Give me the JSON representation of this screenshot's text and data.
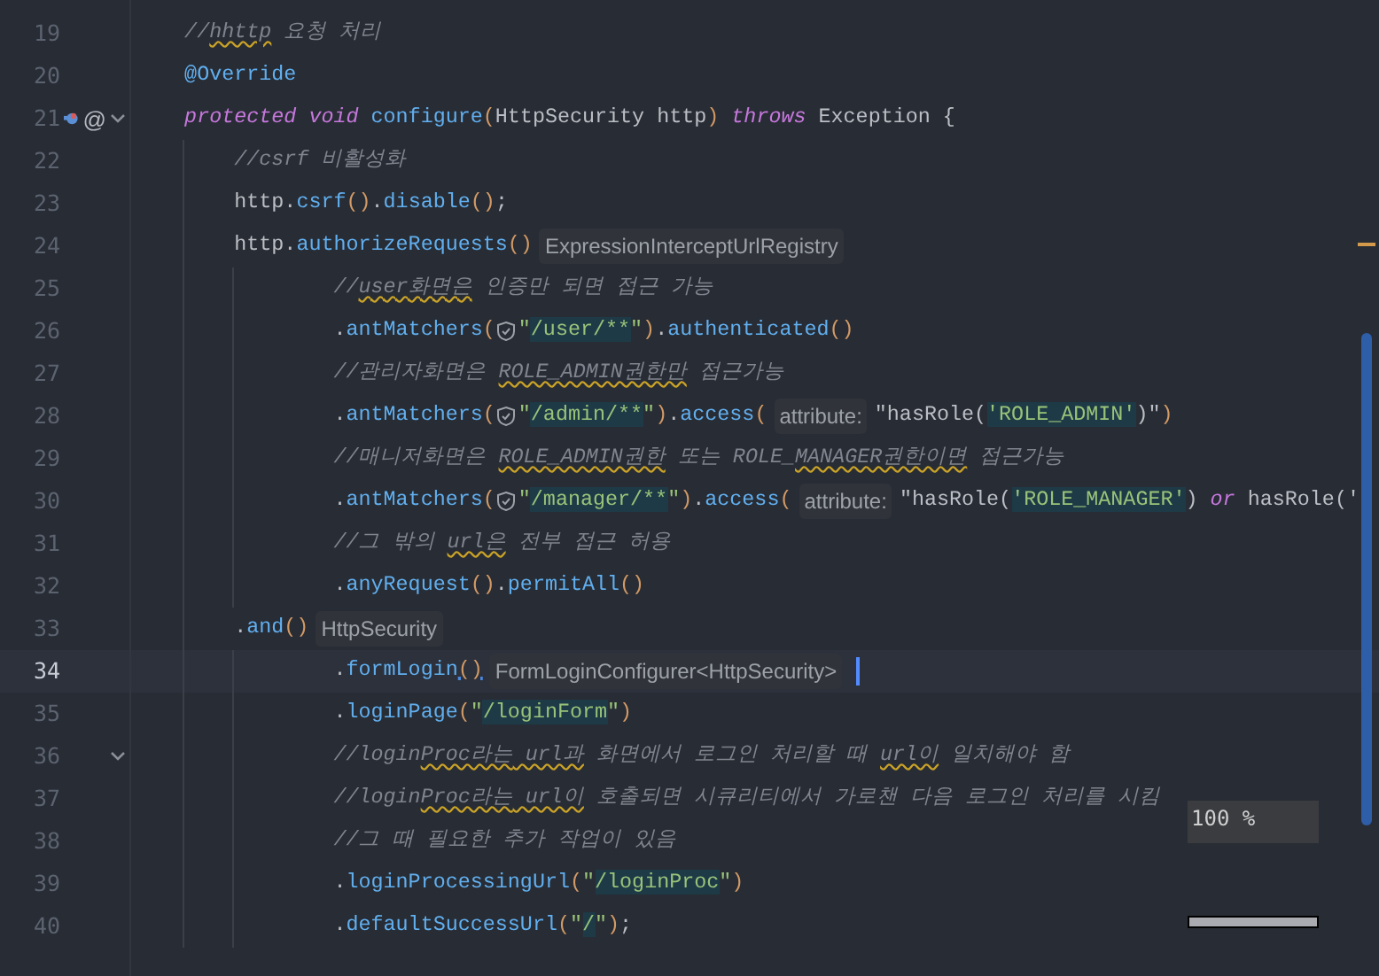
{
  "editor": {
    "lines": [
      {
        "number": "19",
        "current": false,
        "foldable": false,
        "tokens": [
          {
            "kind": "comment",
            "text": "    //"
          },
          {
            "kind": "comment_typo",
            "text": "hhttp"
          },
          {
            "kind": "comment",
            "text": " 요청 처리"
          }
        ]
      },
      {
        "number": "20",
        "current": false,
        "foldable": false,
        "tokens": [
          {
            "kind": "annotation",
            "text": "    @Override"
          }
        ]
      },
      {
        "number": "21",
        "current": false,
        "foldable": true,
        "gutter": [
          {
            "kind": "override"
          },
          {
            "kind": "glyph",
            "text": "@"
          }
        ],
        "tokens": [
          {
            "kind": "keyword",
            "text": "    protected void "
          },
          {
            "kind": "method",
            "text": "configure"
          },
          {
            "kind": "paren",
            "text": "("
          },
          {
            "kind": "plain",
            "text": "HttpSecurity http"
          },
          {
            "kind": "paren",
            "text": ")"
          },
          {
            "kind": "keyword",
            "text": " throws "
          },
          {
            "kind": "plain",
            "text": "Exception {"
          }
        ]
      },
      {
        "number": "22",
        "current": false,
        "foldable": false,
        "tokens": [
          {
            "kind": "comment",
            "text": "        //csrf 비활성화"
          }
        ]
      },
      {
        "number": "23",
        "current": false,
        "foldable": false,
        "tokens": [
          {
            "kind": "plain",
            "text": "        http."
          },
          {
            "kind": "method",
            "text": "csrf"
          },
          {
            "kind": "paren",
            "text": "()"
          },
          {
            "kind": "plain",
            "text": "."
          },
          {
            "kind": "method",
            "text": "disable"
          },
          {
            "kind": "paren",
            "text": "()"
          },
          {
            "kind": "plain",
            "text": ";"
          }
        ]
      },
      {
        "number": "24",
        "current": false,
        "foldable": false,
        "tokens": [
          {
            "kind": "plain",
            "text": "        http."
          },
          {
            "kind": "method",
            "text": "authorizeRequests"
          },
          {
            "kind": "paren",
            "text": "()"
          },
          {
            "kind": "hint",
            "text": "ExpressionInterceptUrlRegistry"
          }
        ]
      },
      {
        "number": "25",
        "current": false,
        "foldable": false,
        "tokens": [
          {
            "kind": "comment",
            "text": "                //"
          },
          {
            "kind": "comment_typo",
            "text": "user화면은"
          },
          {
            "kind": "comment",
            "text": " 인증만 되면 접근 가능"
          }
        ]
      },
      {
        "number": "26",
        "current": false,
        "foldable": false,
        "tokens": [
          {
            "kind": "plain",
            "text": "                ."
          },
          {
            "kind": "method",
            "text": "antMatchers"
          },
          {
            "kind": "paren",
            "text": "("
          },
          {
            "kind": "shield"
          },
          {
            "kind": "string",
            "text": "\""
          },
          {
            "kind": "string_hl",
            "text": "/user/**"
          },
          {
            "kind": "string",
            "text": "\""
          },
          {
            "kind": "paren",
            "text": ")"
          },
          {
            "kind": "plain",
            "text": "."
          },
          {
            "kind": "method",
            "text": "authenticated"
          },
          {
            "kind": "paren",
            "text": "()"
          }
        ]
      },
      {
        "number": "27",
        "current": false,
        "foldable": false,
        "tokens": [
          {
            "kind": "comment",
            "text": "                //관리자화면은 "
          },
          {
            "kind": "comment_typo",
            "text": "ROLE_ADMIN권한만"
          },
          {
            "kind": "comment",
            "text": " 접근가능"
          }
        ]
      },
      {
        "number": "28",
        "current": false,
        "foldable": false,
        "tokens": [
          {
            "kind": "plain",
            "text": "                ."
          },
          {
            "kind": "method",
            "text": "antMatchers"
          },
          {
            "kind": "paren",
            "text": "("
          },
          {
            "kind": "shield"
          },
          {
            "kind": "string",
            "text": "\""
          },
          {
            "kind": "string_hl",
            "text": "/admin/**"
          },
          {
            "kind": "string",
            "text": "\""
          },
          {
            "kind": "paren",
            "text": ")"
          },
          {
            "kind": "plain",
            "text": "."
          },
          {
            "kind": "method",
            "text": "access"
          },
          {
            "kind": "paren",
            "text": "("
          },
          {
            "kind": "hint",
            "text": "attribute:"
          },
          {
            "kind": "plain",
            "text": "\"hasRole("
          },
          {
            "kind": "string_hl",
            "text": "'ROLE_ADMIN'"
          },
          {
            "kind": "plain",
            "text": ")\""
          },
          {
            "kind": "paren",
            "text": ")"
          }
        ]
      },
      {
        "number": "29",
        "current": false,
        "foldable": false,
        "tokens": [
          {
            "kind": "comment",
            "text": "                //매니저화면은 "
          },
          {
            "kind": "comment_typo",
            "text": "ROLE_ADMIN권한"
          },
          {
            "kind": "comment",
            "text": " 또는 ROLE_"
          },
          {
            "kind": "comment_typo",
            "text": "MANAGER권한이면"
          },
          {
            "kind": "comment",
            "text": " 접근가능"
          }
        ]
      },
      {
        "number": "30",
        "current": false,
        "foldable": false,
        "tokens": [
          {
            "kind": "plain",
            "text": "                ."
          },
          {
            "kind": "method",
            "text": "antMatchers"
          },
          {
            "kind": "paren",
            "text": "("
          },
          {
            "kind": "shield"
          },
          {
            "kind": "string",
            "text": "\""
          },
          {
            "kind": "string_hl",
            "text": "/manager/**"
          },
          {
            "kind": "string",
            "text": "\""
          },
          {
            "kind": "paren",
            "text": ")"
          },
          {
            "kind": "plain",
            "text": "."
          },
          {
            "kind": "method",
            "text": "access"
          },
          {
            "kind": "paren",
            "text": "("
          },
          {
            "kind": "hint",
            "text": "attribute:"
          },
          {
            "kind": "plain",
            "text": "\"hasRole("
          },
          {
            "kind": "string_hl",
            "text": "'ROLE_MANAGER'"
          },
          {
            "kind": "plain",
            "text": ")"
          },
          {
            "kind": "keyword",
            "text": " or "
          },
          {
            "kind": "plain",
            "text": "hasRole('"
          }
        ]
      },
      {
        "number": "31",
        "current": false,
        "foldable": false,
        "tokens": [
          {
            "kind": "comment",
            "text": "                //그 밖의 "
          },
          {
            "kind": "comment_typo",
            "text": "url은"
          },
          {
            "kind": "comment",
            "text": " 전부 접근 허용"
          }
        ]
      },
      {
        "number": "32",
        "current": false,
        "foldable": false,
        "tokens": [
          {
            "kind": "plain",
            "text": "                ."
          },
          {
            "kind": "method",
            "text": "anyRequest"
          },
          {
            "kind": "paren",
            "text": "()"
          },
          {
            "kind": "plain",
            "text": "."
          },
          {
            "kind": "method",
            "text": "permitAll"
          },
          {
            "kind": "paren",
            "text": "()"
          }
        ]
      },
      {
        "number": "33",
        "current": false,
        "foldable": false,
        "tokens": [
          {
            "kind": "plain",
            "text": "        ."
          },
          {
            "kind": "method",
            "text": "and"
          },
          {
            "kind": "paren",
            "text": "()"
          },
          {
            "kind": "hint",
            "text": "HttpSecurity"
          }
        ]
      },
      {
        "number": "34",
        "current": true,
        "foldable": false,
        "tokens": [
          {
            "kind": "plain",
            "text": "                ."
          },
          {
            "kind": "method",
            "text": "formLogin"
          },
          {
            "kind": "paren_match",
            "text": "()"
          },
          {
            "kind": "hint",
            "text": "FormLoginConfigurer<HttpSecurity>"
          }
        ]
      },
      {
        "number": "35",
        "current": false,
        "foldable": false,
        "tokens": [
          {
            "kind": "plain",
            "text": "                ."
          },
          {
            "kind": "method",
            "text": "loginPage"
          },
          {
            "kind": "paren",
            "text": "("
          },
          {
            "kind": "string",
            "text": "\""
          },
          {
            "kind": "string_hl",
            "text": "/loginForm"
          },
          {
            "kind": "string",
            "text": "\""
          },
          {
            "kind": "paren",
            "text": ")"
          }
        ]
      },
      {
        "number": "36",
        "current": false,
        "foldable": true,
        "tokens": [
          {
            "kind": "comment",
            "text": "                //login"
          },
          {
            "kind": "comment_typo",
            "text": "Proc라는"
          },
          {
            "kind": "comment_typo",
            "text": " url과"
          },
          {
            "kind": "comment",
            "text": " 화면에서 로그인 처리할 때 "
          },
          {
            "kind": "comment_typo",
            "text": "url이"
          },
          {
            "kind": "comment",
            "text": " 일치해야 함"
          }
        ]
      },
      {
        "number": "37",
        "current": false,
        "foldable": false,
        "tokens": [
          {
            "kind": "comment",
            "text": "                //login"
          },
          {
            "kind": "comment_typo",
            "text": "Proc라는"
          },
          {
            "kind": "comment_typo",
            "text": " url이"
          },
          {
            "kind": "comment",
            "text": " 호출되면 시큐리티에서 가로챈 다음 로그인 처리를 시킴"
          }
        ]
      },
      {
        "number": "38",
        "current": false,
        "foldable": false,
        "tokens": [
          {
            "kind": "comment",
            "text": "                //그 때 필요한 추가 작업이 있음"
          }
        ]
      },
      {
        "number": "39",
        "current": false,
        "foldable": false,
        "tokens": [
          {
            "kind": "plain",
            "text": "                ."
          },
          {
            "kind": "method",
            "text": "loginProcessingUrl"
          },
          {
            "kind": "paren",
            "text": "("
          },
          {
            "kind": "string",
            "text": "\""
          },
          {
            "kind": "string_hl",
            "text": "/loginProc"
          },
          {
            "kind": "string",
            "text": "\""
          },
          {
            "kind": "paren",
            "text": ")"
          }
        ]
      },
      {
        "number": "40",
        "current": false,
        "foldable": false,
        "tokens": [
          {
            "kind": "plain",
            "text": "                ."
          },
          {
            "kind": "method",
            "text": "defaultSuccessUrl"
          },
          {
            "kind": "paren",
            "text": "("
          },
          {
            "kind": "string",
            "text": "\""
          },
          {
            "kind": "string_hl",
            "text": "/"
          },
          {
            "kind": "string",
            "text": "\""
          },
          {
            "kind": "paren",
            "text": ")"
          },
          {
            "kind": "plain",
            "text": ";"
          }
        ]
      }
    ]
  },
  "zoom_indicator": {
    "text": "100 %"
  }
}
